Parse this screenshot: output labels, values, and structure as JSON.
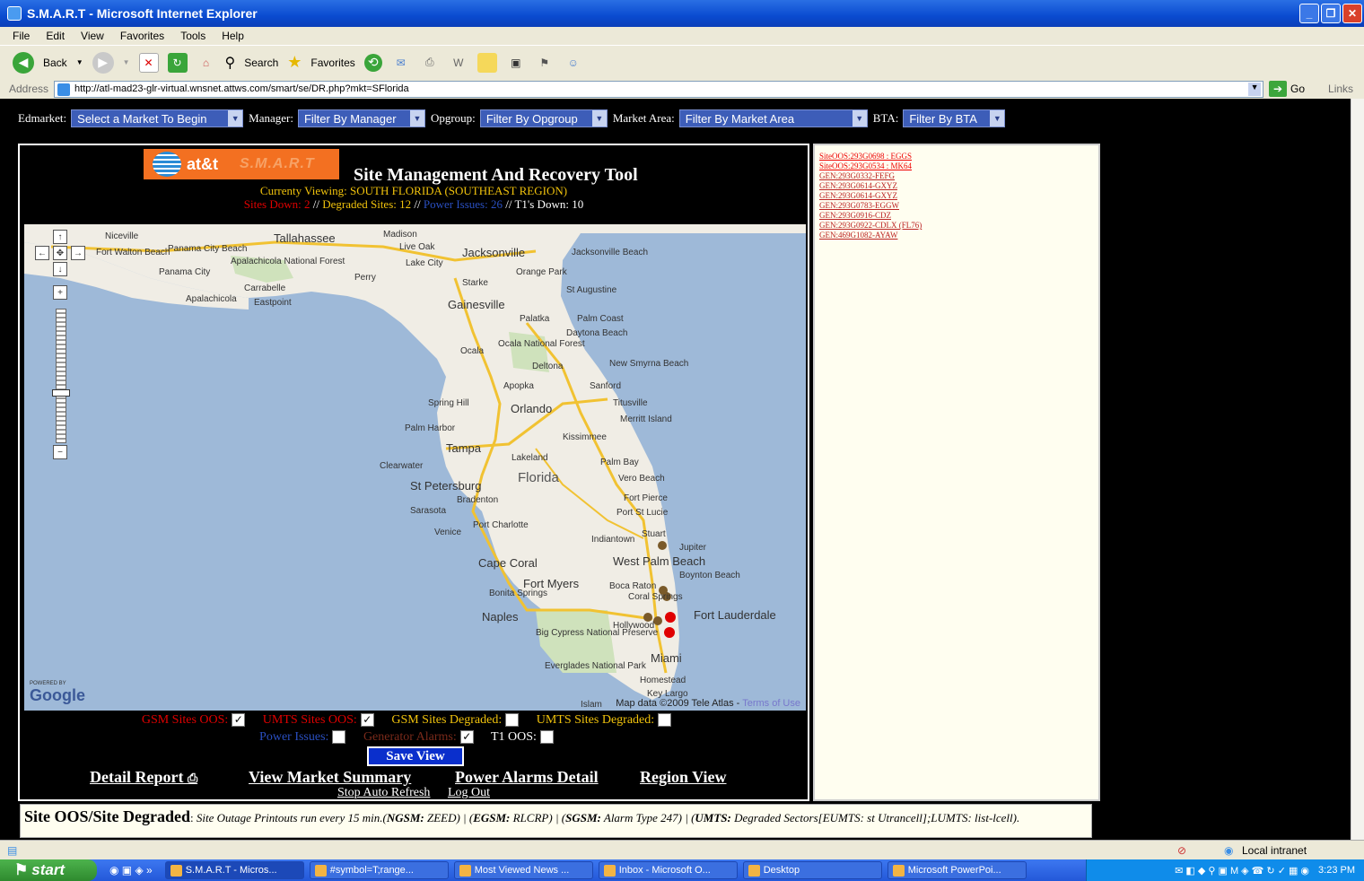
{
  "window": {
    "title": "S.M.A.R.T - Microsoft Internet Explorer"
  },
  "menu": [
    "File",
    "Edit",
    "View",
    "Favorites",
    "Tools",
    "Help"
  ],
  "toolbar": {
    "back": "Back",
    "search": "Search",
    "favorites": "Favorites"
  },
  "address": {
    "label": "Address",
    "url": "http://atl-mad23-glr-virtual.wnsnet.attws.com/smart/se/DR.php?mkt=SFlorida",
    "go": "Go",
    "links": "Links"
  },
  "filters": {
    "edmarket_label": "Edmarket:",
    "edmarket_value": "Select a Market To Begin",
    "manager_label": "Manager:",
    "manager_value": "Filter By Manager",
    "opgroup_label": "Opgroup:",
    "opgroup_value": "Filter By Opgroup",
    "market_area_label": "Market Area:",
    "market_area_value": "Filter By Market Area",
    "bta_label": "BTA:",
    "bta_value": "Filter By BTA"
  },
  "header": {
    "logo_att": "at&t",
    "logo_smart": "S.M.A.R.T",
    "title": "Site Management And Recovery Tool",
    "viewing": "Currenty Viewing: SOUTH FLORIDA  (SOUTHEAST REGION)",
    "sites_down": "Sites Down: 2",
    "degraded": "Degraded Sites: 12",
    "power_issues": "Power Issues: 26",
    "t1_down": "T1's Down: 10",
    "sep": "//"
  },
  "map": {
    "google_powered": "POWERED BY",
    "google": "Google",
    "data_credit": "Map data ©2009 Tele Atlas - ",
    "terms": "Terms of Use",
    "cities": [
      "Niceville",
      "Tallahassee",
      "Madison",
      "Fort Walton Beach",
      "Panama City Beach",
      "Apalachicola National Forest",
      "Panama City",
      "Carrabelle",
      "Apalachicola",
      "Eastpoint",
      "Live Oak",
      "Lake City",
      "Jacksonville",
      "Jacksonville Beach",
      "Perry",
      "Orange Park",
      "Starke",
      "St Augustine",
      "Gainesville",
      "Palatka",
      "Palm Coast",
      "Daytona Beach",
      "Ocala",
      "Ocala National Forest",
      "Deltona",
      "New Smyrna Beach",
      "Apopka",
      "Sanford",
      "Spring Hill",
      "Orlando",
      "Titusville",
      "Merritt Island",
      "Palm Harbor",
      "Kissimmee",
      "Tampa",
      "Clearwater",
      "Lakeland",
      "Palm Bay",
      "St Petersburg",
      "Florida",
      "Vero Beach",
      "Bradenton",
      "Fort Pierce",
      "Sarasota",
      "Port St Lucie",
      "Port Charlotte",
      "Venice",
      "Indiantown",
      "Stuart",
      "Jupiter",
      "Cape Coral",
      "West Palm Beach",
      "Boynton Beach",
      "Fort Myers",
      "Boca Raton",
      "Bonita Springs",
      "Coral Springs",
      "Naples",
      "Fort Lauderdale",
      "Hollywood",
      "Big Cypress National Preserve",
      "Miami",
      "Everglades National Park",
      "Homestead",
      "Key Largo",
      "Islam"
    ]
  },
  "checkboxes": {
    "gsm_oos": "GSM Sites OOS:",
    "umts_oos": "UMTS Sites OOS:",
    "gsm_degraded": "GSM Sites Degraded:",
    "umts_degraded": "UMTS Sites Degraded:",
    "power_issues": "Power Issues:",
    "generator_alarms": "Generator Alarms:",
    "t1_oos": "T1 OOS:"
  },
  "actions": {
    "save_view": "Save View",
    "detail_report": "Detail Report",
    "view_market_summary": "View Market Summary",
    "power_alarms_detail": "Power Alarms Detail",
    "region_view": "Region View",
    "stop_auto_refresh": "Stop Auto Refresh",
    "log_out": "Log Out"
  },
  "side_list": [
    {
      "text": "SiteOOS:293G0698 : EGGS",
      "type": "oos"
    },
    {
      "text": "SiteOOS:293G0534 : MK64",
      "type": "oos"
    },
    {
      "text": "GEN:293G0332-FEFG",
      "type": "gen"
    },
    {
      "text": "GEN:293G0614-GXYZ",
      "type": "gen"
    },
    {
      "text": "GEN:293G0614-GXYZ",
      "type": "gen"
    },
    {
      "text": "GEN:293G0783-EGGW",
      "type": "gen"
    },
    {
      "text": "GEN:293G0916-CDZ",
      "type": "gen"
    },
    {
      "text": "GEN:293G0922-CDLX (FL76)",
      "type": "gen"
    },
    {
      "text": "GEN:469G1082-AYAW",
      "type": "gen"
    }
  ],
  "footer_note": {
    "title": "Site OOS/Site Degraded",
    "text1": "Site Outage Printouts run every 15 min.(",
    "ngsm": "NGSM:",
    "ngsm_val": " ZEED) | (",
    "egsm": "EGSM:",
    "egsm_val": " RLCRP) | (",
    "sgsm": "SGSM:",
    "sgsm_val": " Alarm Type 247) | (",
    "umts": "UMTS:",
    "umts_val": " Degraded Sectors[EUMTS: st Utrancell];LUMTS: list-lcell)."
  },
  "status": {
    "zone": "Local intranet"
  },
  "taskbar": {
    "start": "start",
    "tasks": [
      "S.M.A.R.T - Micros...",
      "#symbol=T;range...",
      "Most Viewed News ...",
      "Inbox - Microsoft O...",
      "Desktop",
      "Microsoft PowerPoi..."
    ],
    "clock": "3:23 PM"
  },
  "colors": {
    "oos_red": "#e00000",
    "degraded_yellow": "#f0c20c",
    "power_blue": "#2a4fc0",
    "brand_orange": "#f37021"
  }
}
